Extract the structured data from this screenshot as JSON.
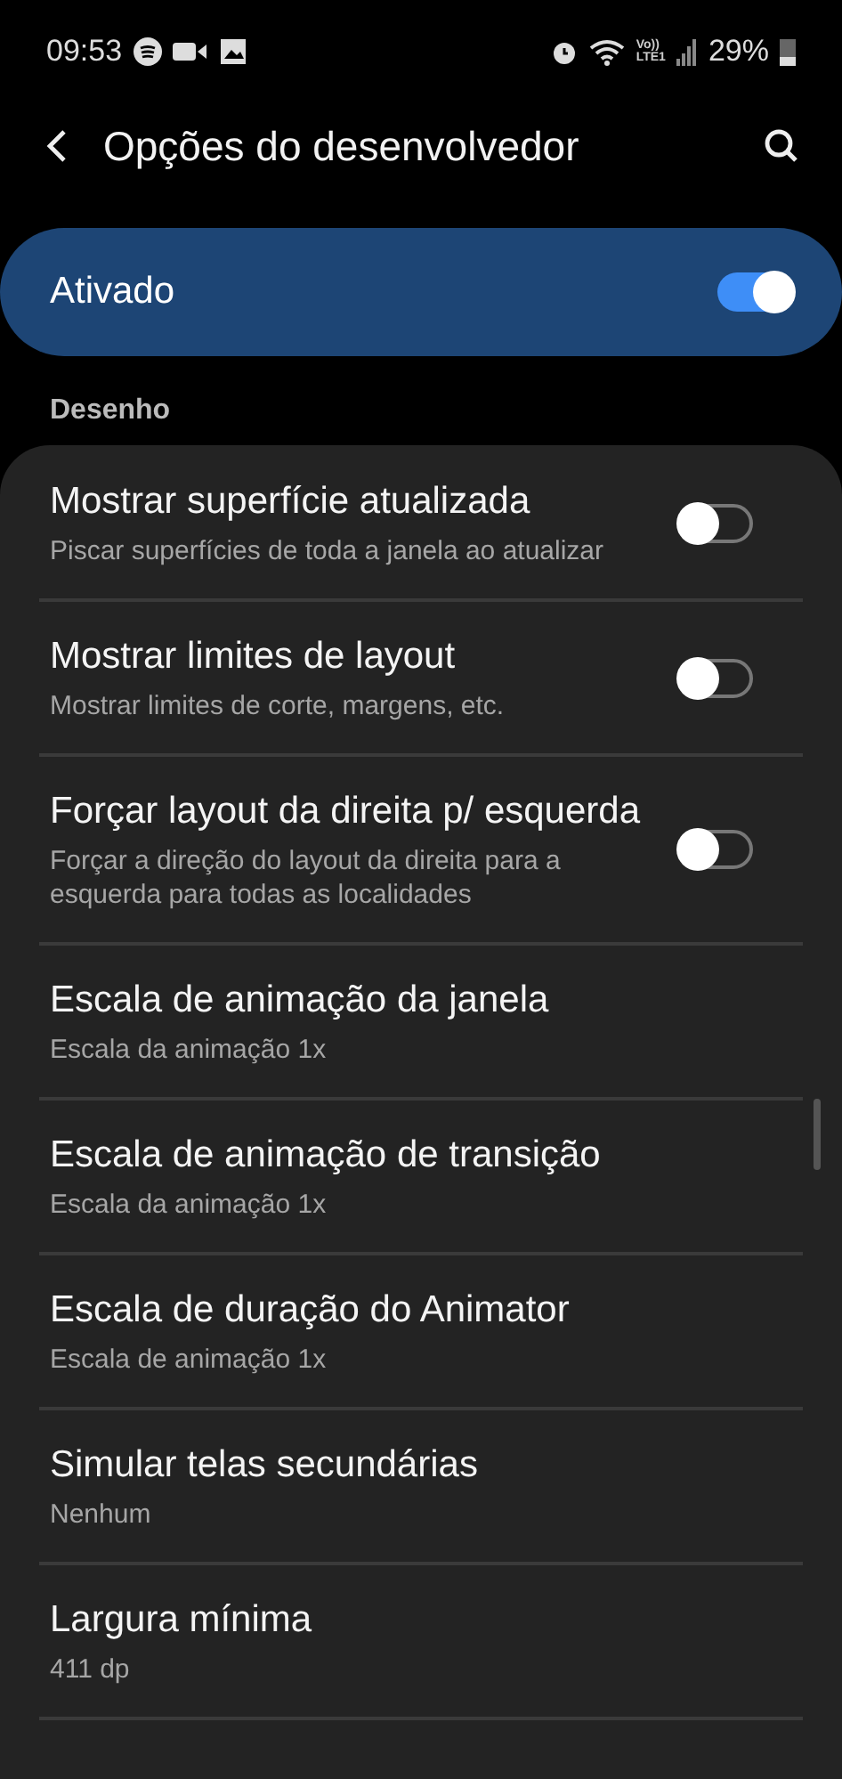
{
  "status_bar": {
    "time": "09:53",
    "network": "Vo))\nLTE1",
    "battery": "29%"
  },
  "header": {
    "title": "Opções do desenvolvedor"
  },
  "master": {
    "label": "Ativado",
    "on": true
  },
  "section": {
    "title": "Desenho"
  },
  "items": [
    {
      "title": "Mostrar superfície atualizada",
      "subtitle": "Piscar superfícies de toda a janela ao atualizar",
      "kind": "switch",
      "on": false
    },
    {
      "title": "Mostrar limites de layout",
      "subtitle": "Mostrar limites de corte, margens, etc.",
      "kind": "switch",
      "on": false
    },
    {
      "title": "Forçar layout da direita p/ esquerda",
      "subtitle": "Forçar a direção do layout da direita para a esquerda para todas as localidades",
      "kind": "switch",
      "on": false
    },
    {
      "title": "Escala de animação da janela",
      "subtitle": "Escala da animação 1x",
      "kind": "value"
    },
    {
      "title": "Escala de animação de transição",
      "subtitle": "Escala da animação 1x",
      "kind": "value"
    },
    {
      "title": "Escala de duração do Animator",
      "subtitle": "Escala de animação 1x",
      "kind": "value"
    },
    {
      "title": "Simular telas secundárias",
      "subtitle": "Nenhum",
      "kind": "value"
    },
    {
      "title": "Largura mínima",
      "subtitle": "411 dp",
      "kind": "value"
    }
  ]
}
